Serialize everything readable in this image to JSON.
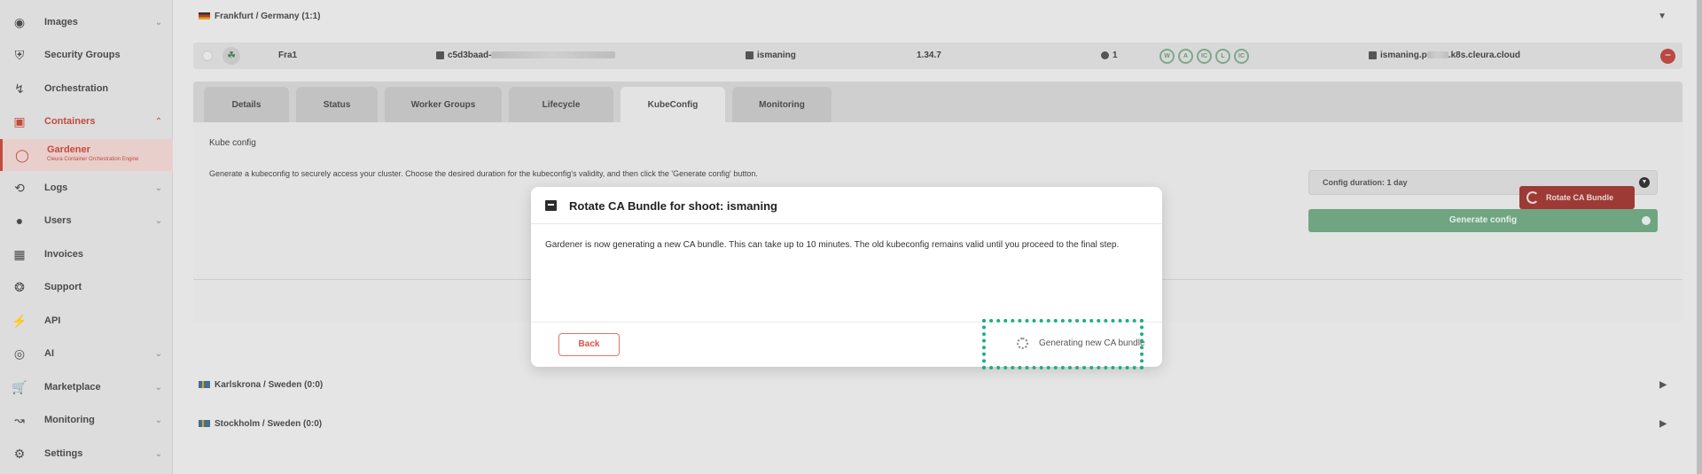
{
  "sidebar": {
    "items": [
      {
        "label": "Images",
        "icon": "camera-icon",
        "has_chevron": true
      },
      {
        "label": "Security Groups",
        "icon": "shield-icon",
        "has_chevron": false
      },
      {
        "label": "Orchestration",
        "icon": "orchestration-icon",
        "has_chevron": false
      },
      {
        "label": "Containers",
        "icon": "cube-icon",
        "has_chevron": true,
        "expanded": true
      },
      {
        "label": "Gardener",
        "sublabel": "Cleura Container Orchestration Engine",
        "icon": "gardener-icon",
        "active": true
      },
      {
        "label": "Logs",
        "icon": "history-icon",
        "has_chevron": true
      },
      {
        "label": "Users",
        "icon": "user-icon",
        "has_chevron": true
      },
      {
        "label": "Invoices",
        "icon": "invoice-icon",
        "has_chevron": false
      },
      {
        "label": "Support",
        "icon": "lifebuoy-icon",
        "has_chevron": false
      },
      {
        "label": "API",
        "icon": "plug-icon",
        "has_chevron": false
      },
      {
        "label": "AI",
        "icon": "ai-icon",
        "has_chevron": true
      },
      {
        "label": "Marketplace",
        "icon": "cart-icon",
        "has_chevron": true
      },
      {
        "label": "Monitoring",
        "icon": "chart-icon",
        "has_chevron": true
      },
      {
        "label": "Settings",
        "icon": "gear-icon",
        "has_chevron": true
      }
    ]
  },
  "regions": {
    "frankfurt": "Frankfurt / Germany (1:1)",
    "karlskrona": "Karlskrona / Sweden (0:0)",
    "stockholm": "Stockholm / Sweden (0:0)"
  },
  "cluster": {
    "name": "Fra1",
    "id_prefix": "c5d3baad-",
    "project": "ismaning",
    "version": "1.34.7",
    "nodes": "1",
    "badges": [
      "W",
      "A",
      "IC",
      "L",
      "IC"
    ],
    "domain_prefix": "ismaning.p",
    "domain_suffix": ".k8s.cleura.cloud"
  },
  "tabs": [
    "Details",
    "Status",
    "Worker Groups",
    "Lifecycle",
    "KubeConfig",
    "Monitoring"
  ],
  "active_tab": "KubeConfig",
  "kubeconfig": {
    "title": "Kube config",
    "description": "Generate a kubeconfig to securely access your cluster. Choose the desired duration for the kubeconfig's validity, and then click the 'Generate config' button.",
    "duration_label": "Config duration: 1 day",
    "generate_label": "Generate config",
    "rotate_label": "Rotate CA Bundle"
  },
  "modal": {
    "title": "Rotate CA Bundle for shoot: ismaning",
    "body": "Gardener is now generating a new CA bundle. This can take up to 10 minutes. The old kubeconfig remains valid until you proceed to the final step.",
    "back_label": "Back",
    "status_label": "Generating new CA bundle"
  },
  "colors": {
    "accent_red": "#c44a3f",
    "accent_green": "#6fa581",
    "highlight": "#1fae86"
  }
}
